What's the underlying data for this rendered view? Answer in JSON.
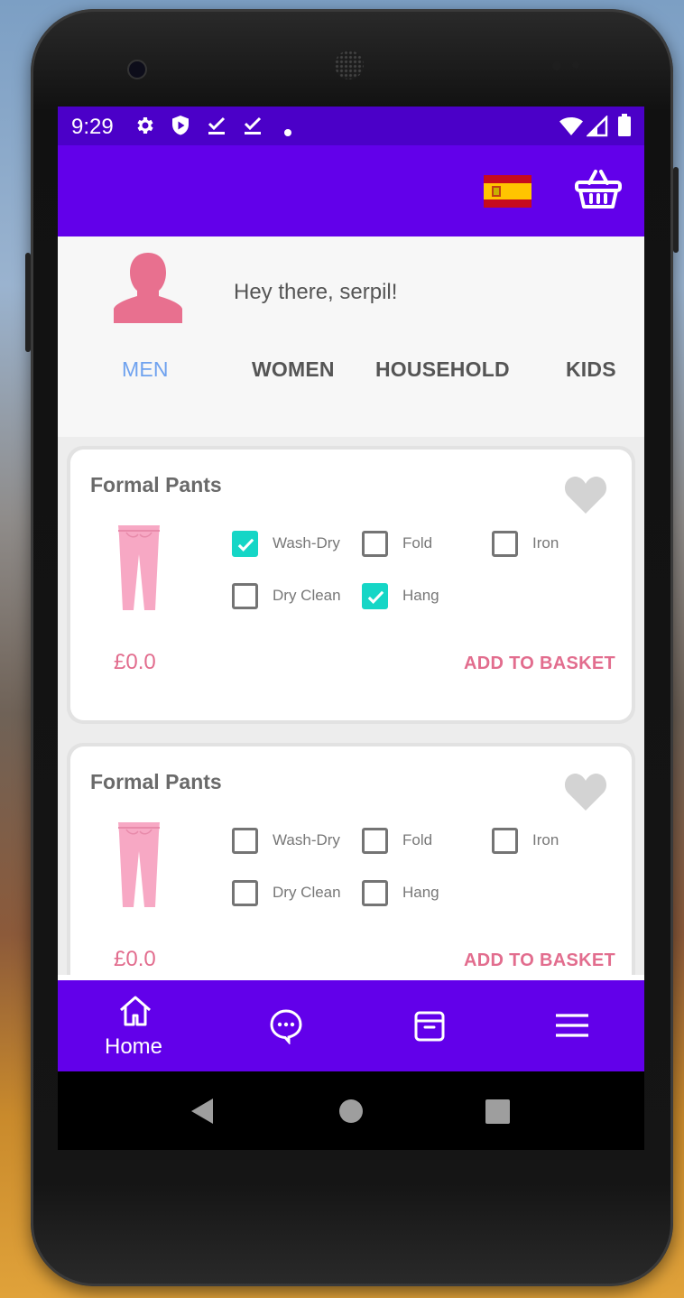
{
  "status_bar": {
    "time": "9:29"
  },
  "header": {
    "greeting": "Hey there, serpil!"
  },
  "tabs": [
    {
      "label": "MEN",
      "active": true
    },
    {
      "label": "WOMEN",
      "active": false
    },
    {
      "label": "HOUSEHOLD",
      "active": false
    },
    {
      "label": "KIDS",
      "active": false
    }
  ],
  "products": [
    {
      "title": "Formal Pants",
      "price": "£0.0",
      "add_label": "ADD TO BASKET",
      "options": [
        {
          "label": "Wash-Dry",
          "checked": true
        },
        {
          "label": "Fold",
          "checked": false
        },
        {
          "label": "Iron",
          "checked": false
        },
        {
          "label": "Dry Clean",
          "checked": false
        },
        {
          "label": "Hang",
          "checked": true
        }
      ]
    },
    {
      "title": "Formal Pants",
      "price": "£0.0",
      "add_label": "ADD TO BASKET",
      "options": [
        {
          "label": "Wash-Dry",
          "checked": false
        },
        {
          "label": "Fold",
          "checked": false
        },
        {
          "label": "Iron",
          "checked": false
        },
        {
          "label": "Dry Clean",
          "checked": false
        },
        {
          "label": "Hang",
          "checked": false
        }
      ]
    }
  ],
  "bottom_nav": {
    "home_label": "Home"
  },
  "colors": {
    "status_bar": "#4b00c8",
    "app_bar": "#6200ea",
    "accent_pink": "#e26d8e",
    "checkbox_checked": "#15d6c6",
    "active_tab": "#6fa2ef"
  },
  "icons": {
    "status": [
      "gear-icon",
      "shield-play-icon",
      "download-done-icon",
      "download-done-icon",
      "dot-icon",
      "wifi-icon",
      "signal-icon",
      "battery-icon"
    ],
    "app_bar": [
      "spain-flag-icon",
      "basket-icon"
    ],
    "nav": [
      "home-icon",
      "chat-icon",
      "archive-icon",
      "menu-icon"
    ],
    "system_nav": [
      "back-icon",
      "home-circle-icon",
      "recents-icon"
    ]
  }
}
